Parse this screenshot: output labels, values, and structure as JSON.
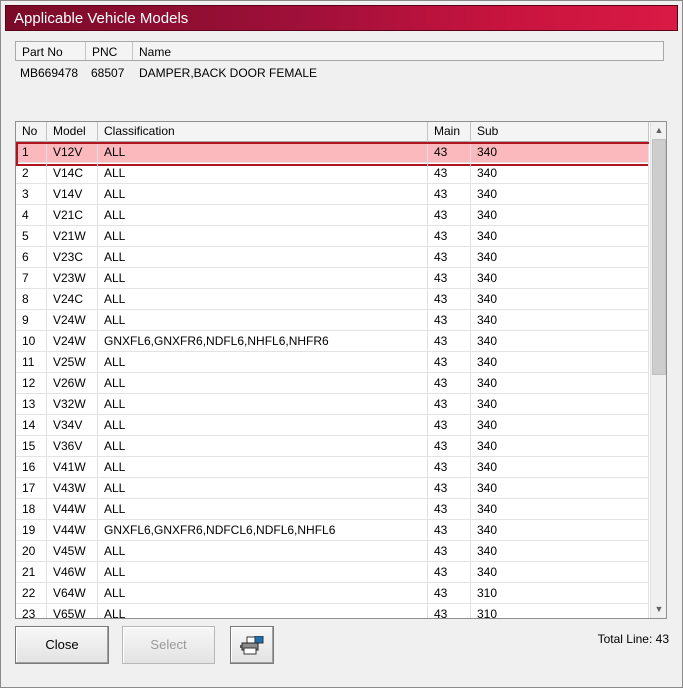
{
  "window": {
    "title": "Applicable Vehicle Models"
  },
  "part": {
    "headers": {
      "part_no": "Part No",
      "pnc": "PNC",
      "name": "Name"
    },
    "row": {
      "part_no": "MB669478",
      "pnc": "68507",
      "name": "DAMPER,BACK DOOR FEMALE"
    }
  },
  "grid": {
    "headers": {
      "no": "No",
      "model": "Model",
      "classification": "Classification",
      "main": "Main",
      "sub": "Sub"
    },
    "selected_index": 0,
    "rows": [
      {
        "no": "1",
        "model": "V12V",
        "classification": "ALL",
        "main": "43",
        "sub": "340"
      },
      {
        "no": "2",
        "model": "V14C",
        "classification": "ALL",
        "main": "43",
        "sub": "340"
      },
      {
        "no": "3",
        "model": "V14V",
        "classification": "ALL",
        "main": "43",
        "sub": "340"
      },
      {
        "no": "4",
        "model": "V21C",
        "classification": "ALL",
        "main": "43",
        "sub": "340"
      },
      {
        "no": "5",
        "model": "V21W",
        "classification": "ALL",
        "main": "43",
        "sub": "340"
      },
      {
        "no": "6",
        "model": "V23C",
        "classification": "ALL",
        "main": "43",
        "sub": "340"
      },
      {
        "no": "7",
        "model": "V23W",
        "classification": "ALL",
        "main": "43",
        "sub": "340"
      },
      {
        "no": "8",
        "model": "V24C",
        "classification": "ALL",
        "main": "43",
        "sub": "340"
      },
      {
        "no": "9",
        "model": "V24W",
        "classification": "ALL",
        "main": "43",
        "sub": "340"
      },
      {
        "no": "10",
        "model": "V24W",
        "classification": "GNXFL6,GNXFR6,NDFL6,NHFL6,NHFR6",
        "main": "43",
        "sub": "340"
      },
      {
        "no": "11",
        "model": "V25W",
        "classification": "ALL",
        "main": "43",
        "sub": "340"
      },
      {
        "no": "12",
        "model": "V26W",
        "classification": "ALL",
        "main": "43",
        "sub": "340"
      },
      {
        "no": "13",
        "model": "V32W",
        "classification": "ALL",
        "main": "43",
        "sub": "340"
      },
      {
        "no": "14",
        "model": "V34V",
        "classification": "ALL",
        "main": "43",
        "sub": "340"
      },
      {
        "no": "15",
        "model": "V36V",
        "classification": "ALL",
        "main": "43",
        "sub": "340"
      },
      {
        "no": "16",
        "model": "V41W",
        "classification": "ALL",
        "main": "43",
        "sub": "340"
      },
      {
        "no": "17",
        "model": "V43W",
        "classification": "ALL",
        "main": "43",
        "sub": "340"
      },
      {
        "no": "18",
        "model": "V44W",
        "classification": "ALL",
        "main": "43",
        "sub": "340"
      },
      {
        "no": "19",
        "model": "V44W",
        "classification": "GNXFL6,GNXFR6,NDFCL6,NDFL6,NHFL6",
        "main": "43",
        "sub": "340"
      },
      {
        "no": "20",
        "model": "V45W",
        "classification": "ALL",
        "main": "43",
        "sub": "340"
      },
      {
        "no": "21",
        "model": "V46W",
        "classification": "ALL",
        "main": "43",
        "sub": "340"
      },
      {
        "no": "22",
        "model": "V64W",
        "classification": "ALL",
        "main": "43",
        "sub": "310"
      },
      {
        "no": "23",
        "model": "V65W",
        "classification": "ALL",
        "main": "43",
        "sub": "310"
      }
    ],
    "scrollbar": {
      "up_icon": "scroll-up-arrow",
      "down_icon": "scroll-down-arrow"
    }
  },
  "buttons": {
    "close": "Close",
    "select": "Select",
    "print_icon": "printer-icon"
  },
  "footer": {
    "total": "Total Line: 43"
  }
}
